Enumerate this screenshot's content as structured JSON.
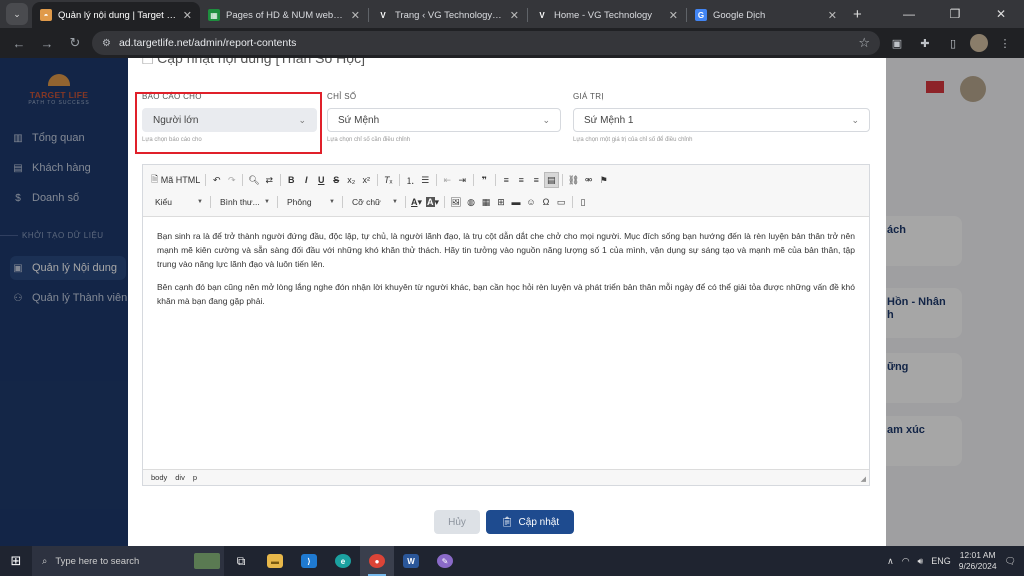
{
  "browser": {
    "tabs": [
      {
        "title": "Quản lý nội dung | Target Life",
        "favicon": "target-life-icon",
        "color": "#e09a4a",
        "active": true
      },
      {
        "title": "Pages of HD & NUM web - Goo",
        "favicon": "sheets-icon",
        "color": "#1e8e3e",
        "active": false
      },
      {
        "title": "Trang ‹ VG Technology — Word",
        "favicon": "v-icon",
        "color": "#ffffff",
        "active": false
      },
      {
        "title": "Home - VG Technology",
        "favicon": "v-icon",
        "color": "#ffffff",
        "active": false
      },
      {
        "title": "Google Dịch",
        "favicon": "translate-icon",
        "color": "#4285f4",
        "active": false
      }
    ],
    "url": "ad.targetlife.net/admin/report-contents"
  },
  "sidebar": {
    "logo": {
      "brand": "TARGET LIFE",
      "tagline": "PATH TO SUCCESS"
    },
    "items": [
      {
        "label": "Tổng quan",
        "icon": "chart-bar-icon"
      },
      {
        "label": "Khách hàng",
        "icon": "user-card-icon"
      },
      {
        "label": "Doanh số",
        "icon": "dollar-icon"
      }
    ],
    "section_label": "KHỞI TẠO DỮ LIỆU",
    "section_items": [
      {
        "label": "Quản lý Nội dung",
        "icon": "image-icon",
        "active": true
      },
      {
        "label": "Quản lý Thành viên",
        "icon": "users-icon",
        "active": false
      }
    ]
  },
  "background_cards": [
    "ách",
    "Hồn - Nhân\nh",
    "ững",
    "am xúc"
  ],
  "modal": {
    "title": "Cập nhật nội dung [Thần Số Học]",
    "fields": [
      {
        "label": "BÁO CÁO CHO",
        "value": "Người lớn",
        "hint": "Lựa chọn báo cáo cho"
      },
      {
        "label": "CHỈ SỐ",
        "value": "Sứ Mệnh",
        "hint": "Lựa chọn chỉ số cần điều chỉnh"
      },
      {
        "label": "GIÁ TRỊ",
        "value": "Sứ Mệnh 1",
        "hint": "Lựa chọn một giá trị của chỉ số để điều chỉnh"
      }
    ],
    "editor": {
      "source_label": "Mã HTML",
      "combos": {
        "style": "Kiểu",
        "format": "Bình thư...",
        "font": "Phông",
        "size": "Cỡ chữ"
      },
      "paragraphs": [
        "Bạn sinh ra là để trở thành người đứng đầu, độc lập, tự chủ, là người lãnh đạo, là trụ cột dẫn dắt che chở cho mọi người. Mục đích sống bạn hướng đến là rèn luyện bản thân trở nên mạnh mẽ kiên cường và sẵn sàng đối đầu với những khó khăn thử thách. Hãy tin tưởng vào nguồn năng lượng số 1 của mình, vận dụng sự sáng tạo và mạnh mẽ của bản thân, tập trung vào năng lực lãnh đạo và luôn tiến lên.",
        "Bên cạnh đó bạn cũng nên mở lòng lắng nghe đón nhận lời khuyên từ người khác, bạn cần học hỏi rèn luyện và phát triển bản thân mỗi ngày để có thể giải tỏa được những vấn đề khó khăn mà bạn đang gặp phải."
      ],
      "path": [
        "body",
        "div",
        "p"
      ]
    },
    "buttons": {
      "cancel": "Hủy",
      "save": "Cập nhật"
    }
  },
  "taskbar": {
    "search_placeholder": "Type here to search",
    "language": "ENG",
    "time": "12:01 AM",
    "date": "9/26/2024"
  },
  "colors": {
    "sidebar": "#1e3a6d",
    "primary": "#1e4b8f",
    "highlight": "#e0202a"
  }
}
